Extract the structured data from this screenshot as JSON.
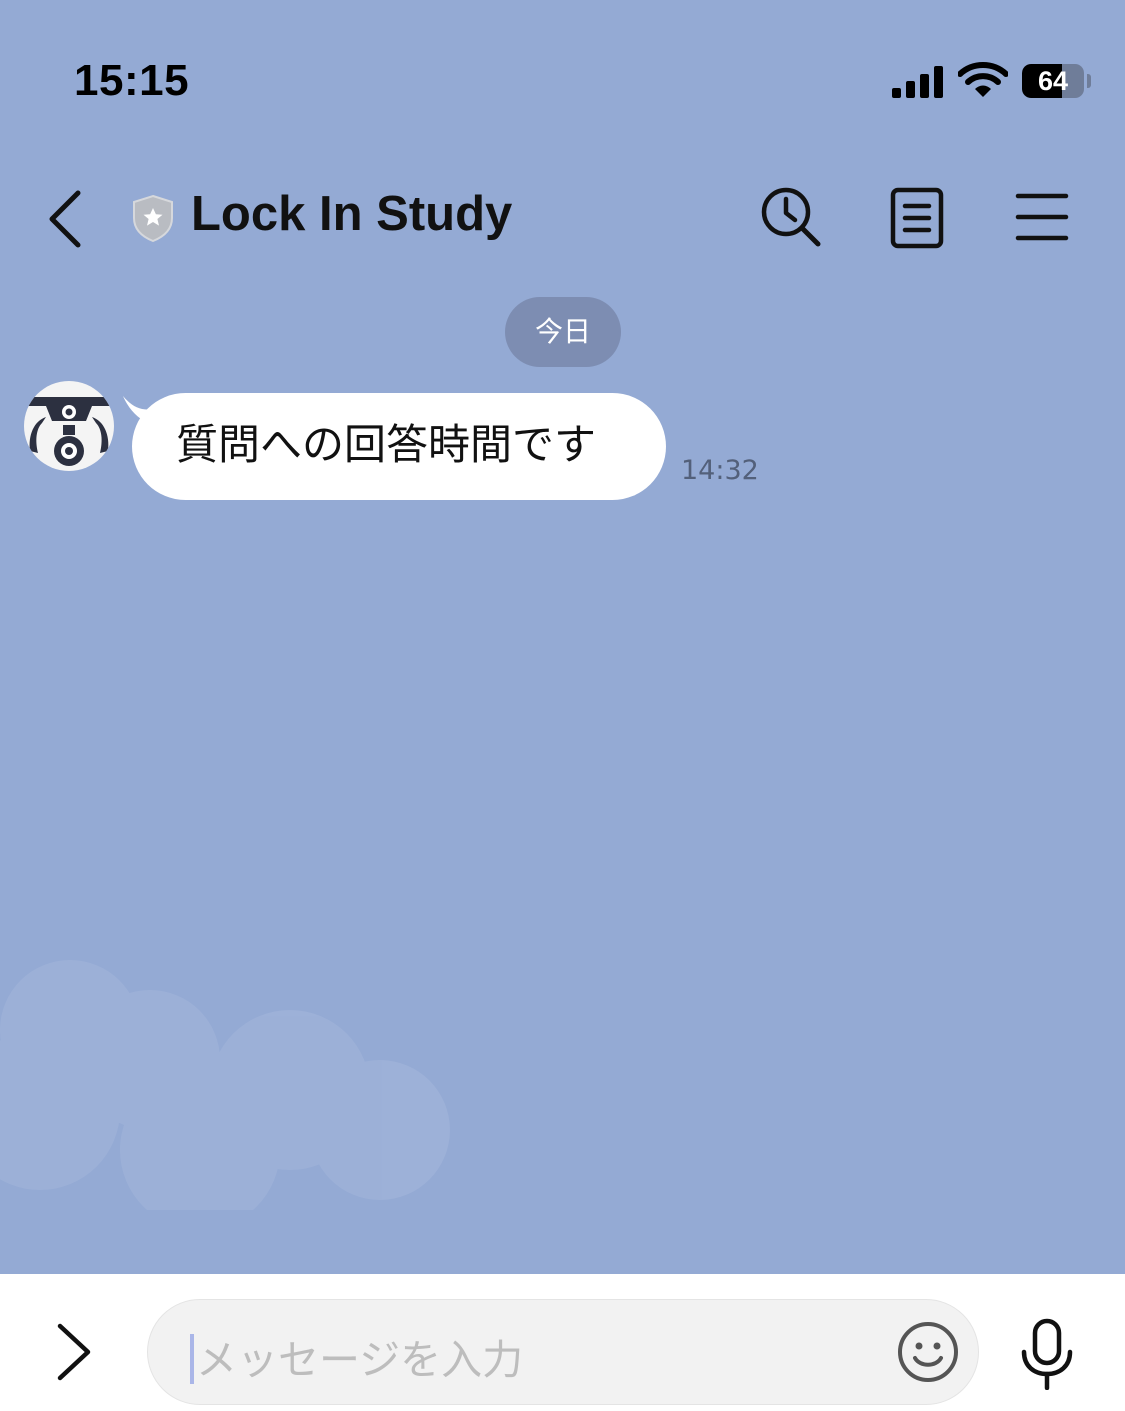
{
  "status_bar": {
    "time": "15:15",
    "battery_percent": "64",
    "battery_level": 0.64
  },
  "header": {
    "title": "Lock In Study",
    "icons": [
      "chevron-left-icon",
      "shield-badge-icon",
      "search-clock-icon",
      "notes-icon",
      "menu-icon"
    ]
  },
  "chat": {
    "date_label": "今日",
    "messages": [
      {
        "text": "質問への回答時間です",
        "time": "14:32",
        "sender": "other"
      }
    ]
  },
  "input": {
    "placeholder": "メッセージを入力",
    "icons": [
      "chevron-right-icon",
      "emoji-icon",
      "microphone-icon"
    ]
  },
  "colors": {
    "background": "#94aad4",
    "bubble": "#ffffff",
    "date_pill": "#7d8db2",
    "input_bar": "#ffffff"
  }
}
